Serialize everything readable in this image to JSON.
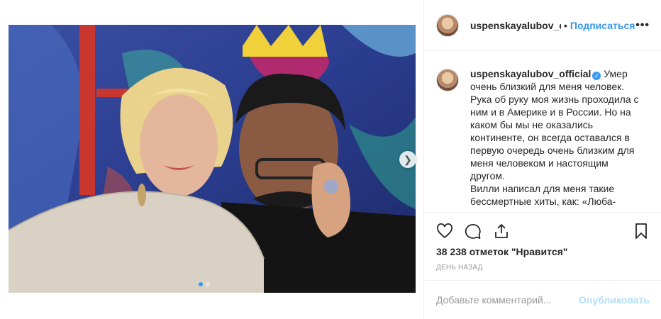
{
  "header": {
    "username": "uspenskayalubov_official",
    "separator": "•",
    "follow_label": "Подписаться",
    "more_label": "•••"
  },
  "caption": {
    "username": "uspenskayalubov_official",
    "verified_icon": "✓",
    "lines": [
      "Умер",
      "очень близкий для меня человек.",
      "Рука об руку моя жизнь проходила с",
      "ним и в Америке и в России. Но на",
      "каком бы мы не оказались",
      "континенте, он всегда оставался в",
      "первую очередь очень близким для",
      "меня человеком и настоящим",
      "другом.",
      "Вилли написал для меня такие",
      "бессмертные хиты, как: «Люба-"
    ]
  },
  "actions": {
    "icons": [
      "heart-icon",
      "comment-icon",
      "share-icon",
      "bookmark-icon"
    ]
  },
  "likes_text": "38 238 отметок \"Нравится\"",
  "date_text": "день назад",
  "comment_box": {
    "placeholder": "Добавьте комментарий...",
    "publish_label": "Опубликовать"
  },
  "carousel": {
    "total": 2,
    "current": 1
  },
  "colors": {
    "accent": "#3897f0",
    "publish_disabled": "#b2dffc",
    "border": "#efefef"
  }
}
